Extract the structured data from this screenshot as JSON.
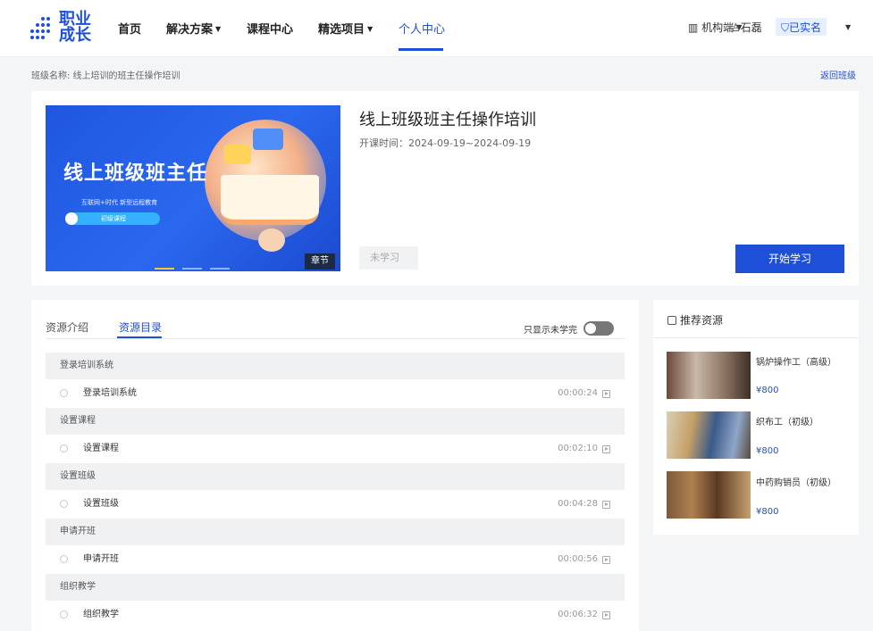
{
  "brand": {
    "line1": "职业",
    "line2": "成长"
  },
  "nav": {
    "home": "首页",
    "solutions": "解决方案",
    "courses": "课程中心",
    "projects": "精选项目",
    "profile": "个人中心"
  },
  "header_right": {
    "org": "机构端",
    "user": "石磊",
    "verified": "已实名"
  },
  "breadcrumb": {
    "label": "班级名称: 线上培训的班主任操作培训",
    "back": "返回班级"
  },
  "banner": {
    "title": "线上班级班主任",
    "subtitle": "互联网+时代 新型远程教育",
    "pill": "初级课程",
    "chapter_tag": "章节"
  },
  "course": {
    "title": "线上班级班主任操作培训",
    "time": "开课时间：2024-09-19~2024-09-19",
    "status": "未学习",
    "start_button": "开始学习"
  },
  "resources": {
    "tab_intro": "资源介绍",
    "tab_catalog": "资源目录",
    "toggle_label": "只显示未学完",
    "rows": [
      {
        "section": "登录培训系统",
        "item": "登录培训系统",
        "duration": "00:00:24"
      },
      {
        "section": "设置课程",
        "item": "设置课程",
        "duration": "00:02:10"
      },
      {
        "section": "设置班级",
        "item": "设置班级",
        "duration": "00:04:28"
      },
      {
        "section": "申请开班",
        "item": "申请开班",
        "duration": "00:00:56"
      },
      {
        "section": "组织教学",
        "item": "组织教学",
        "duration": "00:06:32"
      }
    ]
  },
  "recommend": {
    "header": "推荐资源",
    "items": [
      {
        "name": "锅炉操作工（高级）",
        "price": "¥800"
      },
      {
        "name": "织布工（初级）",
        "price": "¥800"
      },
      {
        "name": "中药购销员（初级）",
        "price": "¥800"
      }
    ]
  },
  "colors": {
    "accent": "#1e4fd9"
  }
}
